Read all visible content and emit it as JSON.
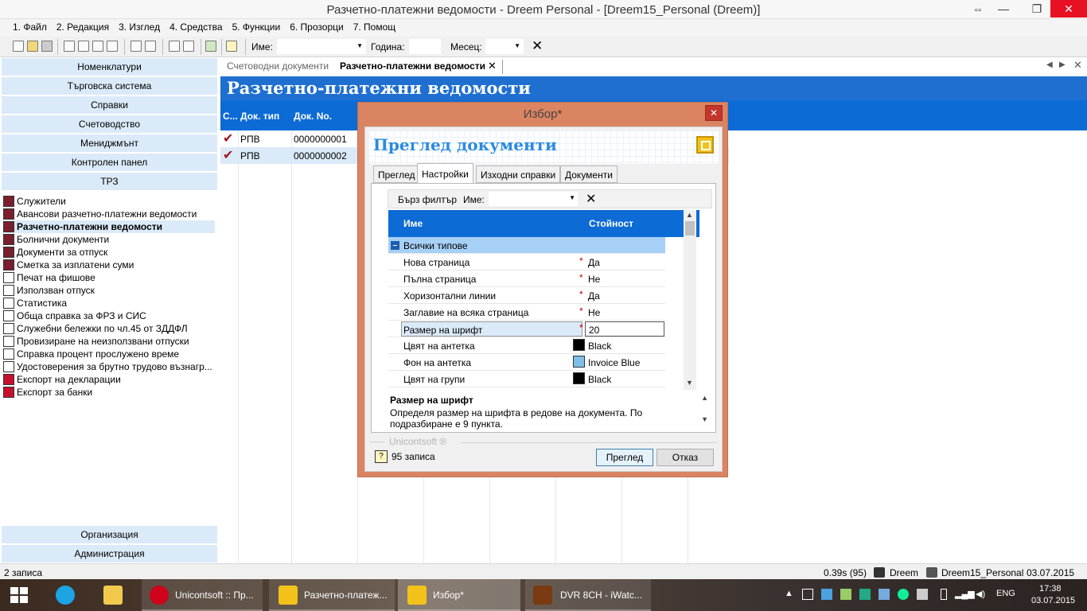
{
  "window": {
    "title": "Разчетно-платежни ведомости - Dreem Personal - [Dreem15_Personal (Dreem)]",
    "restore_glyph": "⇔",
    "minimize_glyph": "—",
    "maximize_glyph": "❐",
    "close_glyph": "✕"
  },
  "menu": [
    "1. Файл",
    "2. Редакция",
    "3. Изглед",
    "4. Средства",
    "5. Функции",
    "6. Прозорци",
    "7. Помощ"
  ],
  "toolbar": {
    "name_label": "Име:",
    "name_value": "",
    "year_label": "Година:",
    "year_value": "",
    "month_label": "Месец:",
    "month_value": ""
  },
  "leftnav": {
    "top_headers": [
      "Номенклатури",
      "Търговска система",
      "Справки",
      "Счетоводство",
      "Мениджмънт",
      "Контролен панел",
      "ТРЗ"
    ],
    "items": [
      "Служители",
      "Авансови разчетно-платежни ведомости",
      "Разчетно-платежни ведомости",
      "Болнични документи",
      "Документи за отпуск",
      "Сметка за изплатени суми",
      "Печат на фишове",
      "Използван отпуск",
      "Статистика",
      "Обща справка за ФРЗ и СИС",
      "Служебни бележки по чл.45 от ЗДДФЛ",
      "Провизиране на неизползвани отпуски",
      "Справка процент прослужено време",
      "Удостоверения за брутно трудово възнагр...",
      "Експорт на декларации",
      "Експорт за банки"
    ],
    "selected_index": 2,
    "bottom_headers": [
      "Организация",
      "Администрация"
    ]
  },
  "tabs": {
    "tab1": "Счетоводни документи",
    "tab2": "Разчетно-платежни ведомости"
  },
  "page_title": "Разчетно-платежни ведомости",
  "grid": {
    "columns": [
      "С...",
      "Док. тип",
      "Док. No."
    ],
    "rows": [
      {
        "type": "РПВ",
        "no": "0000000001"
      },
      {
        "type": "РПВ",
        "no": "0000000002"
      }
    ]
  },
  "dialog": {
    "title": "Избор*",
    "header": "Преглед документи",
    "tabs": [
      "Преглед",
      "Настройки",
      "Изходни справки",
      "Документи"
    ],
    "active_tab": 1,
    "quick_filter": {
      "label": "Бърз филтър",
      "name_label": "Име:",
      "name_value": ""
    },
    "prop_columns": [
      "Име",
      "Стойност"
    ],
    "group": "Всички типове",
    "props": [
      {
        "name": "Нова страница",
        "value": "Да",
        "required": "*"
      },
      {
        "name": "Пълна страница",
        "value": "Не",
        "required": "*"
      },
      {
        "name": "Хоризонтални линии",
        "value": "Да",
        "required": "*"
      },
      {
        "name": "Заглавие на всяка страница",
        "value": "Не",
        "required": "*"
      },
      {
        "name": "Размер на шрифт",
        "value": "20",
        "required": "*"
      },
      {
        "name": "Цвят на антетка",
        "value": "Black",
        "swatch": "#000000"
      },
      {
        "name": "Фон на антетка",
        "value": "Invoice Blue",
        "swatch": "#7fbfea"
      },
      {
        "name": "Цвят на групи",
        "value": "Black",
        "swatch": "#000000"
      }
    ],
    "desc_title": "Размер на шрифт",
    "desc_text": "Определя размер на шрифта в редове на документа. По подразбиране е 9 пункта.",
    "brand": "Unicontsoft ®",
    "records": "95 записа",
    "ok_label": "Преглед",
    "cancel_label": "Отказ"
  },
  "status": {
    "records": "2 записа",
    "timing": "0.39s (95)",
    "user": "Dreem",
    "db": "Dreem15_Personal",
    "date": "03.07.2015"
  },
  "taskbar": {
    "apps": [
      {
        "label": "Unicontsoft :: Пр..."
      },
      {
        "label": "Разчетно-платеж..."
      },
      {
        "label": "Избор*"
      },
      {
        "label": "DVR 8CH - iWatc..."
      }
    ],
    "lang": "ENG",
    "time": "17:38",
    "date": "03.07.2015"
  },
  "colors": {
    "accent": "#0d6bd6",
    "dialog_frame": "#db8462",
    "nav_header": "#dbeaf9"
  }
}
